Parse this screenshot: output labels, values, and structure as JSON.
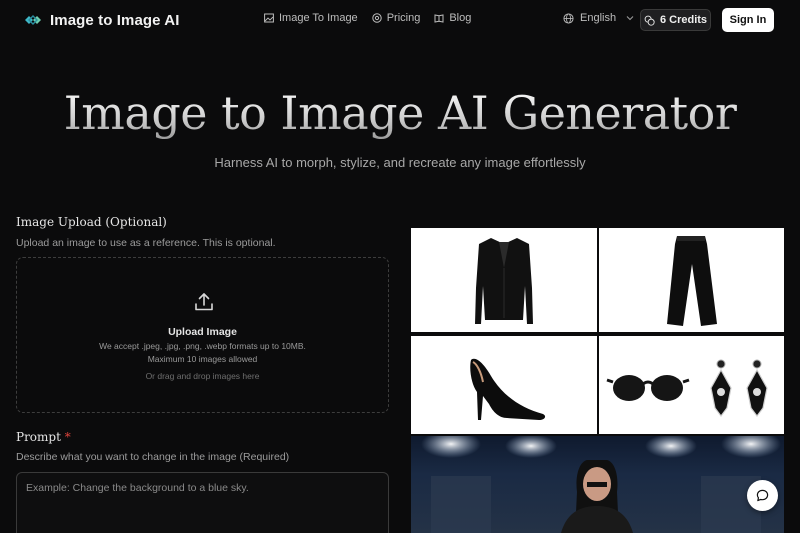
{
  "nav": {
    "brand": "Image to Image AI",
    "menu": [
      {
        "label": "Image To Image",
        "icon": "image-icon"
      },
      {
        "label": "Pricing",
        "icon": "pricing-icon"
      },
      {
        "label": "Blog",
        "icon": "book-icon"
      }
    ],
    "language": "English",
    "credits": "6 Credits",
    "signin": "Sign In"
  },
  "hero": {
    "title": "Image to Image AI Generator",
    "subtitle": "Harness AI to morph, stylize, and recreate any image effortlessly"
  },
  "upload": {
    "title": "Image Upload (Optional)",
    "description": "Upload an image to use as a reference. This is optional.",
    "label": "Upload Image",
    "formats": "We accept .jpeg, .jpg, .png, .webp formats up to 10MB.",
    "max": "Maximum 10 images allowed",
    "drag": "Or drag and drop images here"
  },
  "prompt": {
    "title": "Prompt",
    "required_mark": "*",
    "description": "Describe what you want to change in the image (Required)",
    "placeholder": "Example: Change the background to a blue sky."
  },
  "colors": {
    "background": "#0b0b0c",
    "accent_required": "#e0443c",
    "button_bg": "#ffffff"
  },
  "gallery": {
    "items": [
      "blazer-image",
      "trousers-image",
      "heel-image",
      "sunglasses-earrings-image",
      "runway-model-image"
    ]
  }
}
